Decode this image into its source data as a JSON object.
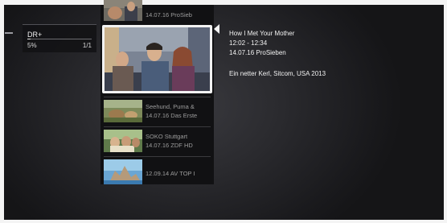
{
  "side_panel": {
    "title": "DR+",
    "progress_percent": "5%",
    "progress_fraction": 0.05,
    "page": "1/1"
  },
  "list": {
    "items": [
      {
        "title": "",
        "sub": "14.07.16 ProSieb"
      },
      {
        "title": "Seehund, Puma &",
        "sub": "14.07.16 Das Erste"
      },
      {
        "title": "SOKO Stuttgart",
        "sub": "14.07.16 ZDF HD"
      },
      {
        "title": "",
        "sub": "12.09.14 AV TOP I"
      }
    ]
  },
  "detail": {
    "title": "How I Met Your Mother",
    "time": "12:02 - 12:34",
    "date_channel": "14.07.16 ProSieben",
    "description": "Ein netter Kerl, Sitcom, USA 2013"
  },
  "colors": {
    "background": "#1b1b1e",
    "panel": "#111113",
    "highlight": "#f2f2f2",
    "text": "#e8e8e8"
  }
}
